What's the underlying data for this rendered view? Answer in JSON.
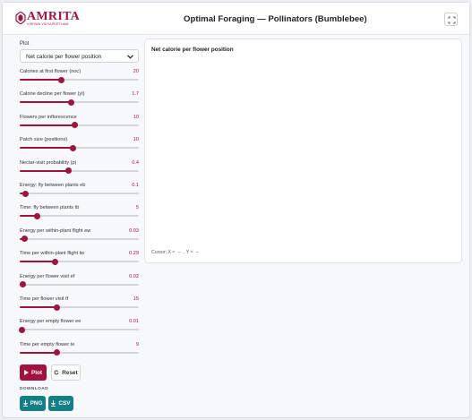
{
  "header": {
    "logo_text": "AMRITA",
    "logo_subtext": "VISHWA VIDYAPEETHAM",
    "title": "Optimal Foraging — Pollinators (Bumblebee)"
  },
  "sidebar": {
    "plot_label": "Plot",
    "plot_selected": "Net calorie per flower position",
    "sliders": [
      {
        "label": "Calories at first flower (noc)",
        "value": "20",
        "level": 0.35
      },
      {
        "label": "Calorie decline per flower (yl)",
        "value": "1.7",
        "level": 0.43
      },
      {
        "label": "Flowers per inflorescence",
        "value": "10",
        "level": 0.46
      },
      {
        "label": "Patch size (positions)",
        "value": "10",
        "level": 0.45
      },
      {
        "label": "Nectar-visit probability (p)",
        "value": "0.4",
        "level": 0.41
      },
      {
        "label": "Energy: fly between plants eb",
        "value": "0.1",
        "level": 0.05
      },
      {
        "label": "Time: fly between plants tb",
        "value": "5",
        "level": 0.15
      },
      {
        "label": "Energy per within-plant flight ew",
        "value": "0.03",
        "level": 0.04
      },
      {
        "label": "Time per within-plant flight tw",
        "value": "0.29",
        "level": 0.3
      },
      {
        "label": "Energy per flower visit ef",
        "value": "0.02",
        "level": 0.03
      },
      {
        "label": "Time per flower visit tf",
        "value": "15",
        "level": 0.31
      },
      {
        "label": "Energy per empty flower ee",
        "value": "0.01",
        "level": 0.02
      },
      {
        "label": "Time per empty flower te",
        "value": "9",
        "level": 0.31
      }
    ],
    "plot_button": "Plot",
    "reset_button": "Reset",
    "download_label": "DOWNLOAD",
    "png_button": "PNG",
    "csv_button": "CSV"
  },
  "chart": {
    "title": "Net calorie per flower position",
    "cursor_x_label": "Cursor: X ≈",
    "cursor_x_value": "–",
    "cursor_y_label": ", Y ≈",
    "cursor_y_value": "–"
  },
  "colors": {
    "accent": "#a0123f",
    "download": "#157f86",
    "track": "#d4d6da"
  }
}
